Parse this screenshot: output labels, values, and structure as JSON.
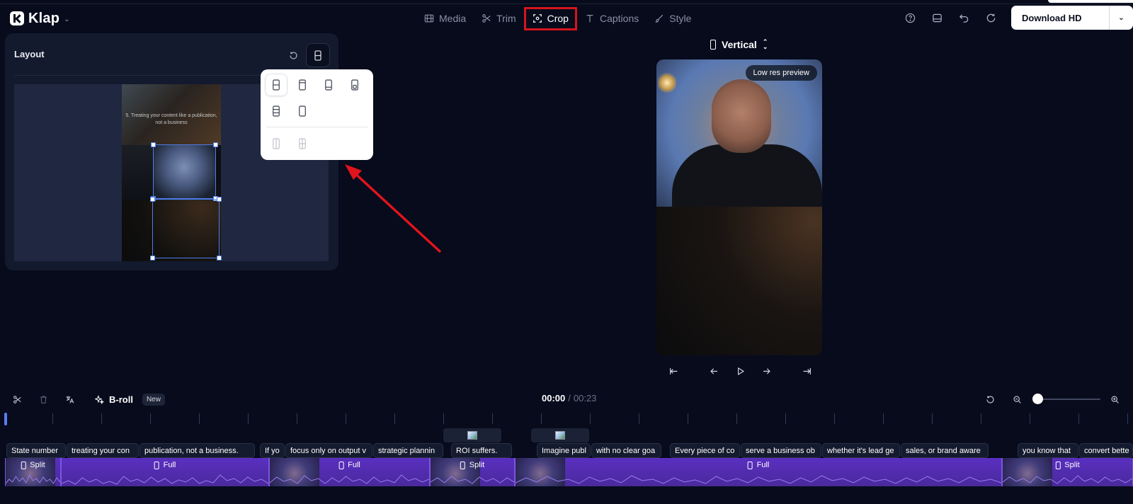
{
  "app": {
    "name": "Klap"
  },
  "nav": {
    "items": [
      {
        "label": "Media",
        "icon": "film-icon"
      },
      {
        "label": "Trim",
        "icon": "scissors-icon"
      },
      {
        "label": "Crop",
        "icon": "crop-icon",
        "active": true
      },
      {
        "label": "Captions",
        "icon": "text-icon"
      },
      {
        "label": "Style",
        "icon": "brush-icon"
      }
    ]
  },
  "toolbar": {
    "download_label": "Download HD"
  },
  "layout_panel": {
    "title": "Layout",
    "source_caption": "5. Treating your content like a publication, not a business"
  },
  "preview": {
    "orientation": "Vertical",
    "badge": "Low res preview"
  },
  "timeline": {
    "broll_label": "B-roll",
    "new_badge": "New",
    "current_time": "00:00",
    "separator": "/",
    "total_time": "00:23",
    "captions": [
      "State number",
      "treating your con",
      "publication, not a business.",
      "If yo",
      "focus only on output v",
      "strategic plannin",
      "ROI suffers.",
      "Imagine publ",
      "with no clear goa",
      "Every piece of co",
      "serve a business ob",
      "whether it's lead ge",
      "sales, or brand aware",
      "you know that",
      "convert bette"
    ],
    "segments": [
      {
        "label": "Split"
      },
      {
        "label": "Full"
      },
      {
        "label": "Full"
      },
      {
        "label": "Split"
      },
      {
        "label": "Full"
      },
      {
        "label": "Split"
      }
    ]
  },
  "colors": {
    "background": "#070b1c",
    "panel": "#131a2e",
    "accent_purple": "#5a2fc0",
    "highlight_red": "#d6151c",
    "crop_blue": "#4f7de6"
  }
}
